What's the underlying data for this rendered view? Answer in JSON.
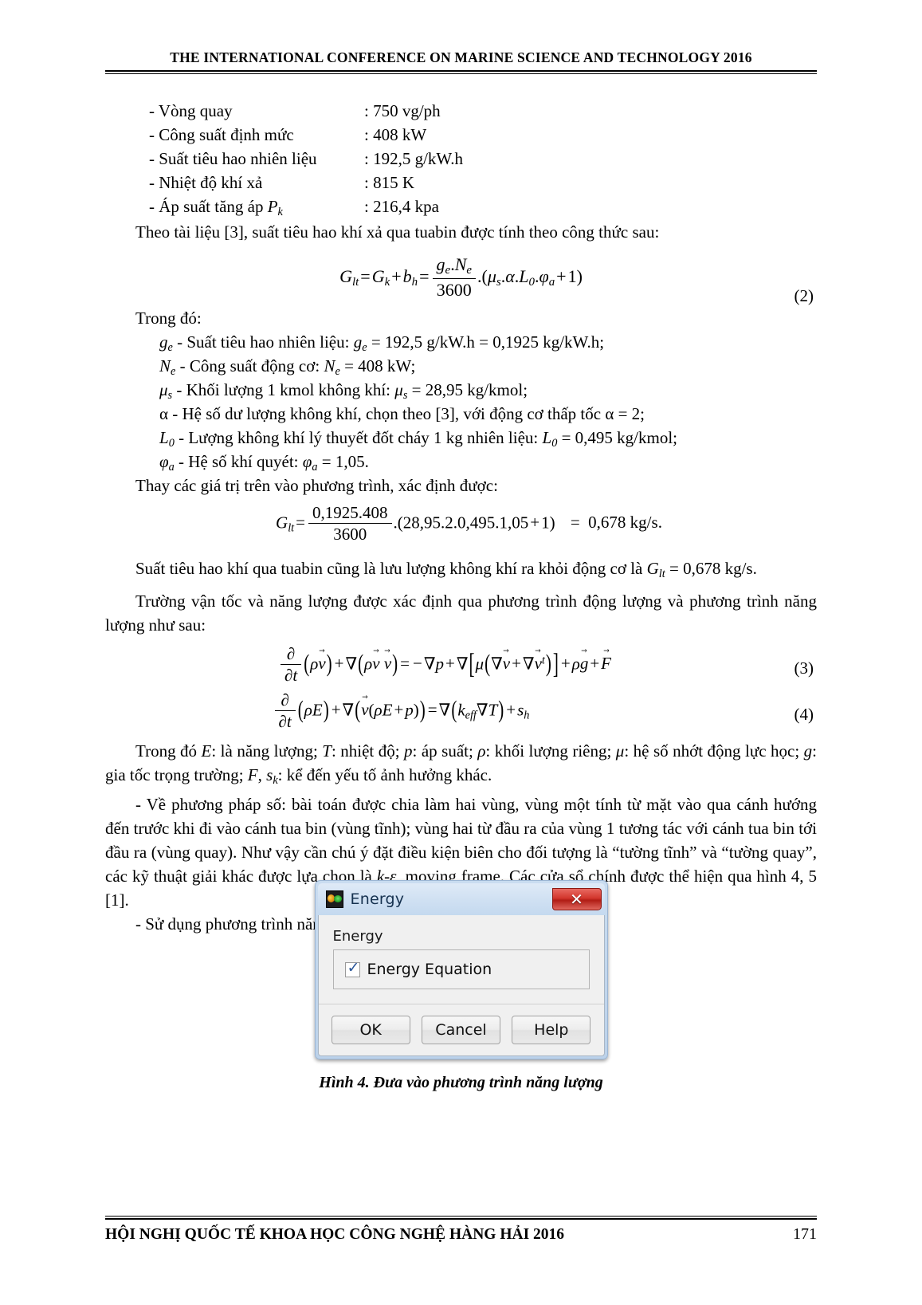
{
  "header": {
    "title": "THE INTERNATIONAL CONFERENCE ON MARINE SCIENCE AND TECHNOLOGY 2016"
  },
  "specs": [
    {
      "label": "- Vòng quay",
      "value": ": 750 vg/ph"
    },
    {
      "label": "- Công suất định mức",
      "value": ": 408 kW"
    },
    {
      "label": "- Suất tiêu hao nhiên liệu",
      "value": ": 192,5 g/kW.h"
    },
    {
      "label": "- Nhiệt độ khí xả",
      "value": ": 815 K"
    },
    {
      "label": "- Áp suất tăng áp Pk",
      "value": ": 216,4 kpa"
    }
  ],
  "paragraphs": {
    "intro_formula": "Theo tài liệu [3], suất tiêu hao khí xả qua tuabin được tính theo công thức sau:",
    "where": "Trong đó:",
    "substitute": "Thay các giá trị trên vào phương trình, xác định được:",
    "result": "Suất tiêu hao khí qua tuabin cũng là lưu lượng không khí ra khỏi động cơ là Glt = 0,678 kg/s.",
    "velocity_field": "Trường vận tốc và năng lượng được xác định qua phương trình động lượng và phương trình năng lượng như sau:",
    "symbols": "Trong đó E: là năng lượng; T: nhiệt độ; p: áp suất; ρ: khối lượng riêng; μ: hệ số nhớt động lực học; g: gia tốc trọng trường; F, sk: kể đến yếu tố ảnh hưởng khác.",
    "numeric_method": "- Về phương pháp số: bài toán được chia làm hai vùng, vùng một tính từ mặt vào qua cánh hướng đến trước khi đi vào cánh tua bin (vùng tĩnh); vùng hai từ đầu ra của vùng 1 tương tác với cánh tua bin tới đầu ra (vùng quay). Như vậy cần chú ý đặt điều kiện biên cho đối tượng là “tường tĩnh” và “tường quay”, các kỹ thuật giải khác được lựa chọn là k-ε, moving frame. Các cửa sổ chính được thể hiện qua hình 4, 5 [1].",
    "use_energy_eq": "- Sử dụng phương trình năng lượng:"
  },
  "definitions": [
    "ge - Suất tiêu hao nhiên liệu: ge = 192,5 g/kW.h = 0,1925 kg/kW.h;",
    "Ne - Công suất động cơ: Ne = 408 kW;",
    "μs - Khối lượng 1 kmol không khí: μs = 28,95 kg/kmol;",
    "α - Hệ số dư lượng không khí, chọn theo [3], với động cơ thấp tốc α = 2;",
    "L0 - Lượng không khí lý thuyết đốt cháy 1 kg nhiên liệu: L0 = 0,495 kg/kmol;",
    "φa - Hệ số khí quyét: φa = 1,05."
  ],
  "equations": {
    "eq2": {
      "number": "(2)",
      "text": "Glt = Gk + bh = (ge.Ne / 3600).(μs.α.L0.φa + 1)",
      "lhs": "G",
      "lhs_sub": "lt",
      "numerator": "g e .N e",
      "denominator": "3600",
      "tail": ".(μs.α.L0.φa + 1)"
    },
    "eq_numeric": {
      "lhs": "G",
      "lhs_sub": "lt",
      "numerator": "0,1925.408",
      "denominator": "3600",
      "tail": ".(28,95.2.0,495.1,05 + 1)",
      "result": "=  0,678 kg/s.",
      "text": "Glt = (0,1925.408 / 3600).(28,95.2.0,495.1,05+1) = 0,678 kg/s."
    },
    "eq3": {
      "number": "(3)",
      "text": "∂/∂t (ρv) + ∇(ρv v) = −∇p + ∇[μ(∇v + ∇v′)] + ρg + F"
    },
    "eq4": {
      "number": "(4)",
      "text": "∂/∂t (ρE) + ∇(v(ρE + p)) = ∇(keff ∇T) + sh"
    }
  },
  "dialog": {
    "title": "Energy",
    "icon": "energy-app-icon",
    "close_label": "✕",
    "group_label": "Energy",
    "checkbox": {
      "label": "Energy Equation",
      "checked": true,
      "tick": "✓"
    },
    "buttons": [
      {
        "label": "OK"
      },
      {
        "label": "Cancel"
      },
      {
        "label": "Help"
      }
    ]
  },
  "figure": {
    "caption": "Hình 4. Đưa vào phương trình năng lượng"
  },
  "footer": {
    "text": "HỘI NGHỊ QUỐC TẾ KHOA HỌC CÔNG NGHỆ HÀNG HẢI 2016",
    "page": "171"
  },
  "colors": {
    "close_button": "#d2362c",
    "titlebar": "#cfe0f2",
    "check_tick": "#2a5699"
  }
}
